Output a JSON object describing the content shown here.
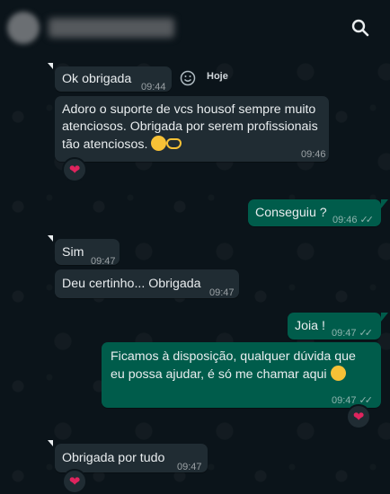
{
  "header": {
    "search_icon": "search-icon"
  },
  "messages": [
    {
      "id": "m1",
      "direction": "in",
      "text": "Ok obrigada",
      "time": "09:44"
    },
    {
      "id": "m2",
      "direction": "in",
      "lines": [
        "Adoro o suporte de vcs housof sempre muito",
        "atenciosos. Obrigada por serem profissionais",
        "tão atenciosos."
      ],
      "time": "09:46",
      "reaction": "heart"
    },
    {
      "id": "m3",
      "direction": "out",
      "text": "Conseguiu ?",
      "time": "09:46",
      "status": "read"
    },
    {
      "id": "m4",
      "direction": "in",
      "text": "Sim",
      "time": "09:47"
    },
    {
      "id": "m5",
      "direction": "in",
      "text": "Deu certinho... Obrigada",
      "time": "09:47"
    },
    {
      "id": "m6",
      "direction": "out",
      "text": "Joia !",
      "time": "09:47",
      "status": "read"
    },
    {
      "id": "m7",
      "direction": "out",
      "lines": [
        "Ficamos à disposição, qualquer dúvida que",
        "eu possa ajudar, é só me chamar aqui"
      ],
      "time": "09:47",
      "status": "read",
      "reaction": "heart"
    },
    {
      "id": "m8",
      "direction": "in",
      "text": "Obrigada por tudo",
      "time": "09:47",
      "reaction": "heart"
    }
  ],
  "day_label": "Hoje",
  "colors": {
    "background": "#0b141a",
    "incoming_bubble": "#202c33",
    "outgoing_bubble": "#005c4b",
    "heart": "#e0245e"
  }
}
